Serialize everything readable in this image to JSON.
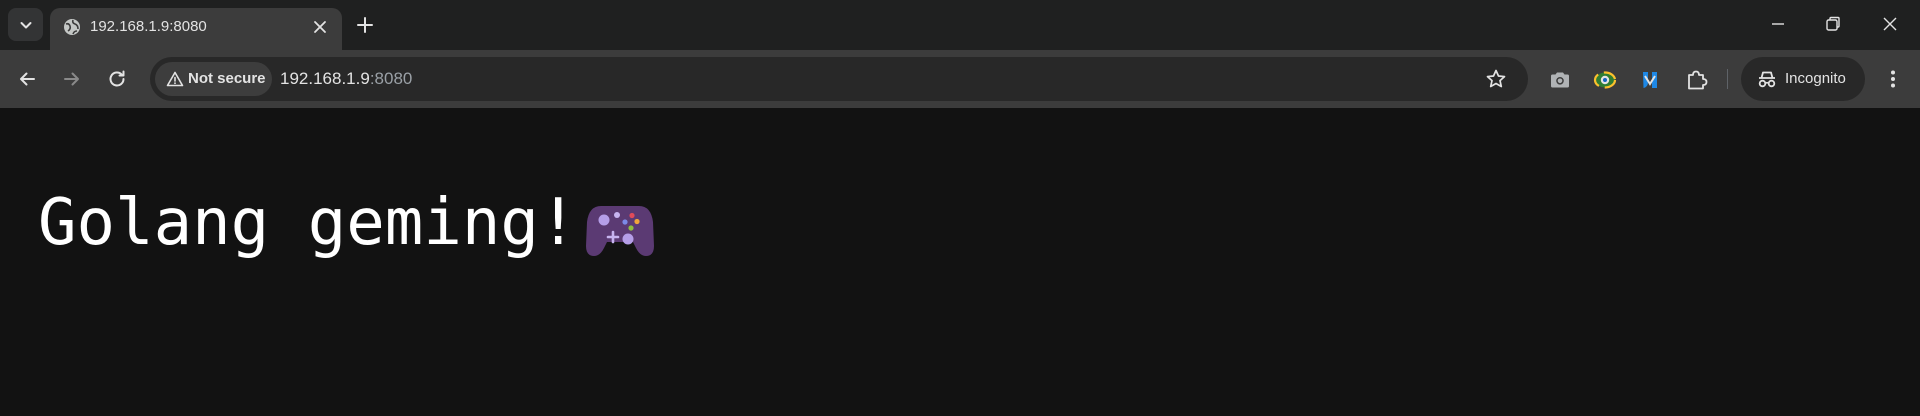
{
  "browser": {
    "tab": {
      "title": "192.168.1.9:8080",
      "favicon": "globe-icon"
    },
    "window_controls": [
      "minimize-icon",
      "restore-icon",
      "close-icon"
    ],
    "toolbar": {
      "security_chip": "Not secure",
      "url_host": "192.168.1.9",
      "url_port": ":8080",
      "extensions": [
        "camera-icon",
        "eye-dropper-icon",
        "translate-icon",
        "puzzle-icon"
      ],
      "profile_label": "Incognito"
    }
  },
  "page": {
    "heading": "Golang geming! ",
    "emoji": "gamepad-icon"
  },
  "colors": {
    "tabstrip_bg": "#1f2020",
    "toolbar_bg": "#3c3c3c",
    "page_bg": "#121212",
    "text": "#e3e3e3"
  }
}
